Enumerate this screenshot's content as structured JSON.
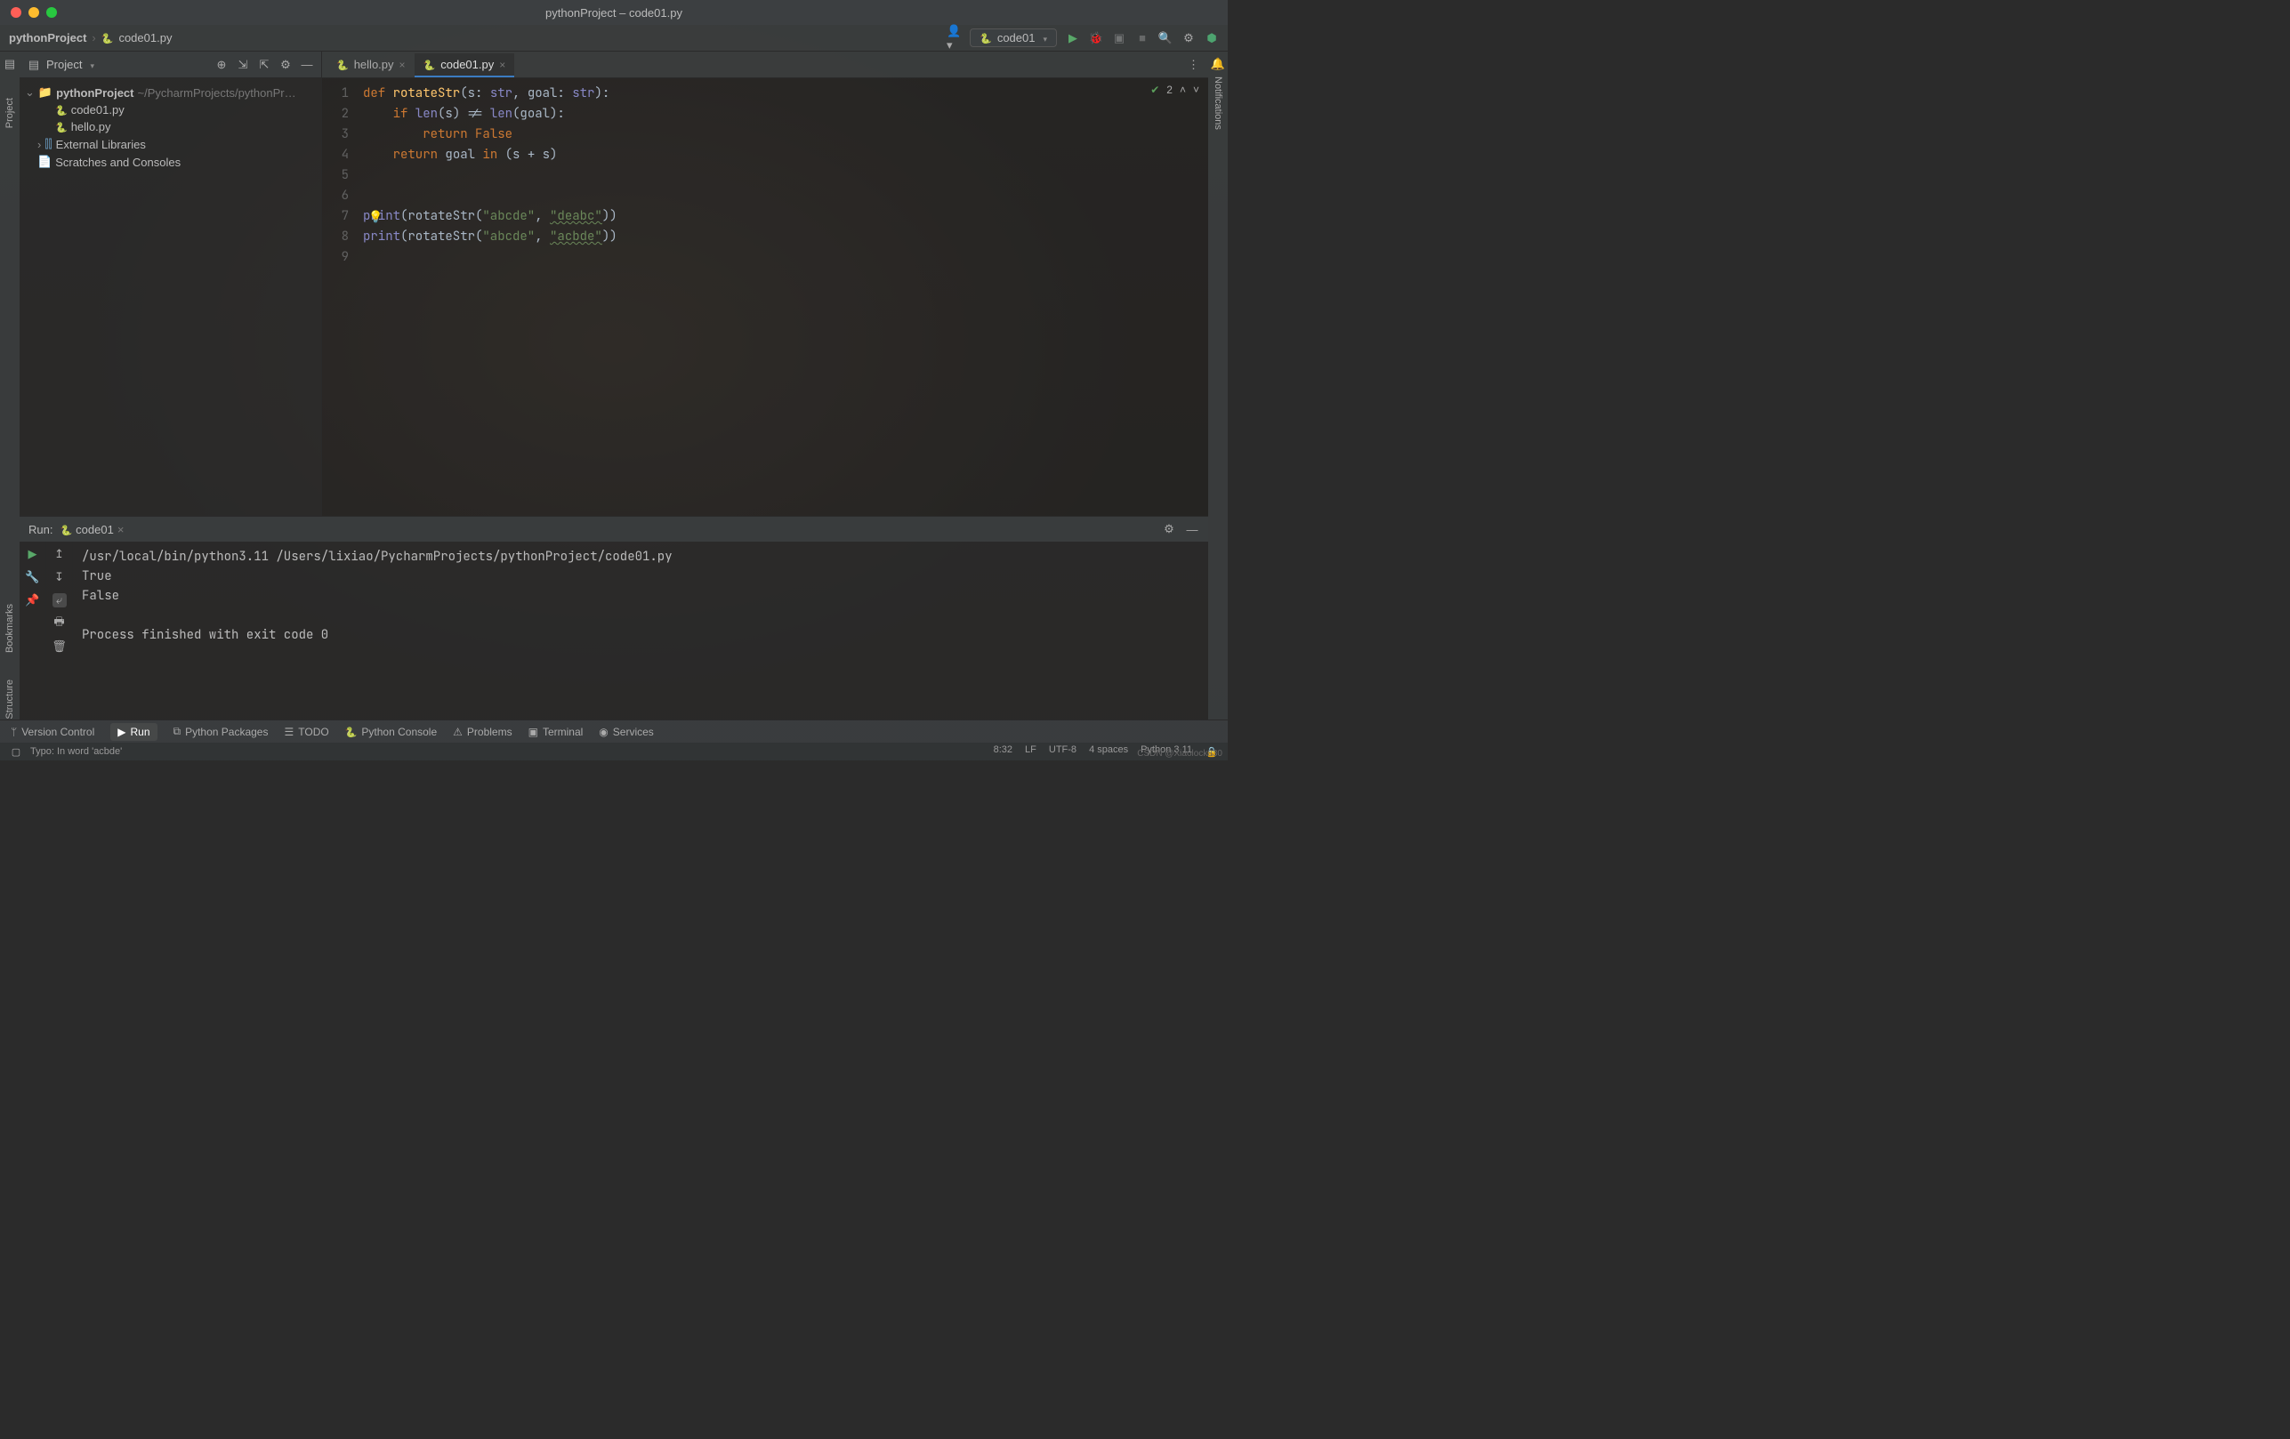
{
  "window": {
    "title": "pythonProject – code01.py"
  },
  "breadcrumb": {
    "project": "pythonProject",
    "file": "code01.py"
  },
  "run_config": {
    "label": "code01"
  },
  "project_tool": {
    "title": "Project",
    "root": "pythonProject",
    "root_path": "~/PycharmProjects/pythonPr…",
    "files": [
      "code01.py",
      "hello.py"
    ],
    "external": "External Libraries",
    "scratches": "Scratches and Consoles"
  },
  "left_rail": {
    "project": "Project",
    "bookmarks": "Bookmarks",
    "structure": "Structure"
  },
  "right_rail": {
    "notifications": "Notifications"
  },
  "editor": {
    "tabs": [
      {
        "label": "hello.py",
        "active": false
      },
      {
        "label": "code01.py",
        "active": true
      }
    ],
    "lines": [
      "1",
      "2",
      "3",
      "4",
      "5",
      "6",
      "7",
      "8",
      "9"
    ],
    "inspections_count": "2",
    "code": {
      "l1": {
        "def": "def ",
        "fn": "rotateStr",
        "rest1": "(s: ",
        "t1": "str",
        "c1": ", goal: ",
        "t2": "str",
        "rest2": "):"
      },
      "l2": {
        "if": "if ",
        "len1": "len",
        "p1": "(s) != ",
        "len2": "len",
        "p2": "(goal):"
      },
      "l3": {
        "ret": "return ",
        "false": "False"
      },
      "l4": {
        "ret": "return ",
        "rest": "goal ",
        "in": "in",
        "rest2": " (s + s)"
      },
      "l7": {
        "print": "print",
        "p1": "(rotateStr(",
        "s1": "\"abcde\"",
        "c": ", ",
        "s2": "\"deabc\"",
        "p2": "))"
      },
      "l8": {
        "print": "print",
        "p1": "(rotateStr(",
        "s1": "\"abcde\"",
        "c": ", ",
        "s2": "\"acbde\"",
        "p2": "))"
      }
    }
  },
  "run_panel": {
    "label": "Run:",
    "config": "code01",
    "output": [
      "/usr/local/bin/python3.11 /Users/lixiao/PycharmProjects/pythonProject/code01.py",
      "True",
      "False",
      "",
      "Process finished with exit code 0"
    ]
  },
  "bottom_bar": {
    "vcs": "Version Control",
    "run": "Run",
    "pkgs": "Python Packages",
    "todo": "TODO",
    "console": "Python Console",
    "problems": "Problems",
    "terminal": "Terminal",
    "services": "Services"
  },
  "status": {
    "typo": "Typo: In word 'acbde'",
    "pos": "8:32",
    "sep": "LF",
    "enc": "UTF-8",
    "indent": "4 spaces",
    "interp": "Python 3.11"
  },
  "watermark": "CSDN @Xiaolock830"
}
